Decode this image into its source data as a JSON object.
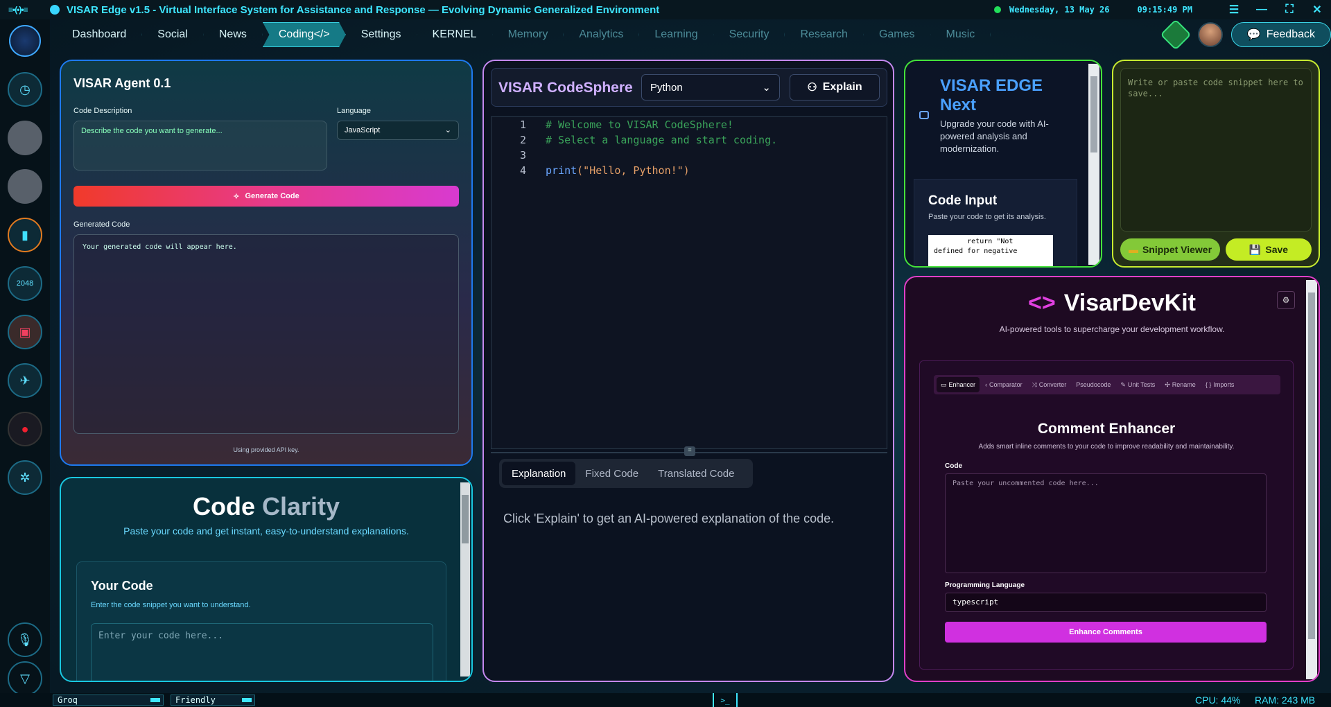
{
  "titlebar": {
    "logo_text": "≡•(•)•≡",
    "title": "VISAR Edge v1.5 - Virtual Interface System for Assistance and Response — Evolving Dynamic Generalized Environment",
    "date": "Wednesday, 13 May 26",
    "time": "09:15:49 PM"
  },
  "nav": {
    "tabs": [
      {
        "label": "Dashboard"
      },
      {
        "label": "Social"
      },
      {
        "label": "News"
      },
      {
        "label": "Coding</>"
      },
      {
        "label": "Settings"
      },
      {
        "label": "KERNEL"
      },
      {
        "label": "Memory"
      },
      {
        "label": "Analytics"
      },
      {
        "label": "Learning"
      },
      {
        "label": "Security"
      },
      {
        "label": "Research"
      },
      {
        "label": "Games"
      },
      {
        "label": "Music"
      }
    ],
    "feedback_label": "Feedback"
  },
  "agent": {
    "title": "VISAR Agent 0.1",
    "desc_label": "Code Description",
    "desc_placeholder": "Describe the code you want to generate...",
    "lang_label": "Language",
    "lang_value": "JavaScript",
    "generate_label": "Generate Code",
    "generated_label": "Generated Code",
    "generated_placeholder": "Your generated code will appear here.",
    "api_note": "Using provided API key."
  },
  "clarity": {
    "title_a": "Code",
    "title_b": "Clarity",
    "subtitle": "Paste your code and get instant, easy-to-understand explanations.",
    "card_title": "Your Code",
    "card_desc": "Enter the code snippet you want to understand.",
    "input_placeholder": "Enter your code here..."
  },
  "codesphere": {
    "brand": "VISAR CodeSphere",
    "language": "Python",
    "explain_label": "Explain",
    "lines": [
      {
        "n": "1",
        "text": "# Welcome to VISAR CodeSphere!"
      },
      {
        "n": "2",
        "text": "# Select a language and start coding."
      },
      {
        "n": "3",
        "text": ""
      },
      {
        "n": "4",
        "fn": "print",
        "str": "(\"Hello, Python!\")"
      }
    ],
    "tabs": [
      {
        "label": "Explanation"
      },
      {
        "label": "Fixed Code"
      },
      {
        "label": "Translated Code"
      }
    ],
    "explain_text": "Click 'Explain' to get an AI-powered explanation of the code."
  },
  "edge": {
    "title": "VISAR EDGE Next",
    "desc": "Upgrade your code with AI-powered analysis and modernization.",
    "card_title": "Code Input",
    "card_desc": "Paste your code to get its analysis.",
    "code_snippet": "        return \"Not\ndefined for negative"
  },
  "snippet": {
    "placeholder": "Write or paste code snippet here to save...",
    "viewer_label": "Snippet Viewer",
    "save_label": "Save"
  },
  "devkit": {
    "title": "VisarDevKit",
    "subtitle": "AI-powered tools to supercharge your development workflow.",
    "tools": [
      {
        "label": "Enhancer"
      },
      {
        "label": "Comparator"
      },
      {
        "label": "Converter"
      },
      {
        "label": "Pseudocode"
      },
      {
        "label": "Unit Tests"
      },
      {
        "label": "Rename"
      },
      {
        "label": "Imports"
      }
    ],
    "section_title": "Comment Enhancer",
    "section_desc": "Adds smart inline comments to your code to improve readability and maintainability.",
    "code_label": "Code",
    "code_placeholder": "Paste your uncommented code here...",
    "lang_label": "Programming Language",
    "lang_value": "typescript",
    "submit_label": "Enhance Comments"
  },
  "status": {
    "provider": "Groq",
    "persona": "Friendly",
    "terminal": ">_",
    "cpu": "CPU: 44%",
    "ram": "RAM: 243 MB"
  }
}
